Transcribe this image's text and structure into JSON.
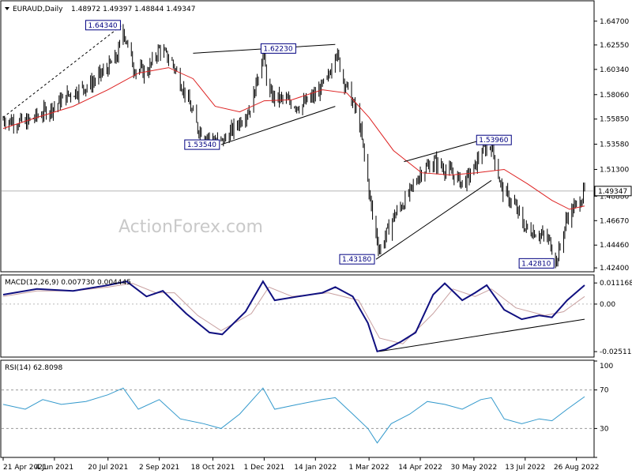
{
  "header": {
    "symbol": "EURAUD,Daily",
    "ohlc": "1.48972 1.49397 1.48844 1.49347",
    "watermark": "ActionForex.com"
  },
  "colors": {
    "candle": "#000000",
    "ma": "#dd2222",
    "macd": "#101080",
    "signal": "#c8a0a0",
    "rsi": "#3399cc",
    "grid": "#d8d8d8",
    "watermark": "#c9c9c9"
  },
  "chart_data": [
    {
      "type": "candlestick",
      "name": "price",
      "ylim": [
        1.4205,
        1.6647
      ],
      "yticks": [
        "1.64700",
        "1.62550",
        "1.60340",
        "1.58060",
        "1.55850",
        "1.53580",
        "1.51300",
        "1.48880",
        "1.46670",
        "1.44460",
        "1.42400"
      ],
      "current_price_label": "1.49347",
      "current_price": 1.49347,
      "annotations": [
        {
          "label": "1.64340",
          "value": 1.6434,
          "date": "2021-08-01",
          "anchor": "left"
        },
        {
          "label": "1.62230",
          "value": 1.6223,
          "date": "2021-12-01",
          "anchor": "right"
        },
        {
          "label": "1.53540",
          "value": 1.5354,
          "date": "2021-10-25",
          "anchor": "left"
        },
        {
          "label": "1.53960",
          "value": 1.5396,
          "date": "2022-06-04",
          "anchor": "right"
        },
        {
          "label": "1.43180",
          "value": 1.4318,
          "date": "2022-03-07",
          "anchor": "left"
        },
        {
          "label": "1.42810",
          "value": 1.4281,
          "date": "2022-08-08",
          "anchor": "left"
        }
      ],
      "trendlines": [
        {
          "style": "dashed",
          "from": [
            "2021-04-21",
            1.56
          ],
          "to": [
            "2021-08-01",
            1.6434
          ]
        },
        {
          "style": "solid",
          "from": [
            "2021-10-01",
            1.618
          ],
          "to": [
            "2022-01-31",
            1.626
          ]
        },
        {
          "style": "solid",
          "from": [
            "2021-10-25",
            1.5354
          ],
          "to": [
            "2022-01-31",
            1.57
          ]
        },
        {
          "style": "solid",
          "from": [
            "2022-03-31",
            1.52
          ],
          "to": [
            "2022-06-14",
            1.542
          ]
        },
        {
          "style": "solid",
          "from": [
            "2022-03-07",
            1.4318
          ],
          "to": [
            "2022-06-14",
            1.503
          ]
        }
      ],
      "close_path": [
        [
          "2021-04-21",
          1.558
        ],
        [
          "2021-05-10",
          1.555
        ],
        [
          "2021-06-04",
          1.57
        ],
        [
          "2021-06-15",
          1.58
        ],
        [
          "2021-07-05",
          1.59
        ],
        [
          "2021-07-20",
          1.605
        ],
        [
          "2021-07-28",
          1.615
        ],
        [
          "2021-08-02",
          1.64
        ],
        [
          "2021-08-11",
          1.605
        ],
        [
          "2021-08-22",
          1.6
        ],
        [
          "2021-09-02",
          1.622
        ],
        [
          "2021-09-13",
          1.61
        ],
        [
          "2021-09-25",
          1.58
        ],
        [
          "2021-10-05",
          1.55
        ],
        [
          "2021-10-18",
          1.54
        ],
        [
          "2021-10-26",
          1.538
        ],
        [
          "2021-11-05",
          1.55
        ],
        [
          "2021-11-20",
          1.57
        ],
        [
          "2021-11-30",
          1.62
        ],
        [
          "2021-12-05",
          1.58
        ],
        [
          "2021-12-20",
          1.575
        ],
        [
          "2022-01-01",
          1.57
        ],
        [
          "2022-01-14",
          1.58
        ],
        [
          "2022-01-25",
          1.595
        ],
        [
          "2022-01-31",
          1.622
        ],
        [
          "2022-02-07",
          1.595
        ],
        [
          "2022-02-20",
          1.56
        ],
        [
          "2022-02-27",
          1.51
        ],
        [
          "2022-03-04",
          1.47
        ],
        [
          "2022-03-10",
          1.44
        ],
        [
          "2022-03-22",
          1.47
        ],
        [
          "2022-04-04",
          1.49
        ],
        [
          "2022-04-14",
          1.51
        ],
        [
          "2022-04-26",
          1.52
        ],
        [
          "2022-05-10",
          1.51
        ],
        [
          "2022-05-21",
          1.5
        ],
        [
          "2022-05-31",
          1.515
        ],
        [
          "2022-06-05",
          1.53
        ],
        [
          "2022-06-14",
          1.535
        ],
        [
          "2022-06-23",
          1.495
        ],
        [
          "2022-07-04",
          1.48
        ],
        [
          "2022-07-13",
          1.46
        ],
        [
          "2022-07-25",
          1.455
        ],
        [
          "2022-08-03",
          1.448
        ],
        [
          "2022-08-09",
          1.43
        ],
        [
          "2022-08-18",
          1.47
        ],
        [
          "2022-08-29",
          1.485
        ],
        [
          "2022-09-02",
          1.4935
        ]
      ],
      "ma_path": [
        [
          "2021-04-21",
          1.55
        ],
        [
          "2021-05-20",
          1.56
        ],
        [
          "2021-06-20",
          1.57
        ],
        [
          "2021-07-20",
          1.585
        ],
        [
          "2021-08-15",
          1.6
        ],
        [
          "2021-09-10",
          1.605
        ],
        [
          "2021-10-01",
          1.595
        ],
        [
          "2021-10-20",
          1.57
        ],
        [
          "2021-11-10",
          1.565
        ],
        [
          "2021-12-01",
          1.575
        ],
        [
          "2021-12-25",
          1.576
        ],
        [
          "2022-01-20",
          1.585
        ],
        [
          "2022-02-10",
          1.582
        ],
        [
          "2022-03-01",
          1.56
        ],
        [
          "2022-03-22",
          1.53
        ],
        [
          "2022-04-15",
          1.51
        ],
        [
          "2022-05-10",
          1.508
        ],
        [
          "2022-06-01",
          1.51
        ],
        [
          "2022-06-25",
          1.513
        ],
        [
          "2022-07-15",
          1.5
        ],
        [
          "2022-08-05",
          1.485
        ],
        [
          "2022-08-20",
          1.477
        ],
        [
          "2022-09-02",
          1.48
        ]
      ]
    },
    {
      "type": "line",
      "name": "macd",
      "title": "MACD(12,26,9) 0.007730 0.004445",
      "ylim": [
        -0.028,
        0.015
      ],
      "yticks": [
        "0.011168",
        "0.00",
        "-0.025117"
      ],
      "series": [
        {
          "name": "macd",
          "points": [
            [
              "2021-04-21",
              0.005
            ],
            [
              "2021-05-20",
              0.008
            ],
            [
              "2021-06-20",
              0.007
            ],
            [
              "2021-07-20",
              0.01
            ],
            [
              "2021-08-05",
              0.012
            ],
            [
              "2021-08-22",
              0.004
            ],
            [
              "2021-09-05",
              0.007
            ],
            [
              "2021-09-25",
              -0.005
            ],
            [
              "2021-10-15",
              -0.015
            ],
            [
              "2021-10-26",
              -0.016
            ],
            [
              "2021-11-15",
              -0.004
            ],
            [
              "2021-11-30",
              0.012
            ],
            [
              "2021-12-10",
              0.002
            ],
            [
              "2021-12-30",
              0.004
            ],
            [
              "2022-01-20",
              0.006
            ],
            [
              "2022-01-31",
              0.009
            ],
            [
              "2022-02-15",
              0.004
            ],
            [
              "2022-02-28",
              -0.01
            ],
            [
              "2022-03-08",
              -0.025
            ],
            [
              "2022-03-15",
              -0.024
            ],
            [
              "2022-03-28",
              -0.02
            ],
            [
              "2022-04-10",
              -0.015
            ],
            [
              "2022-04-25",
              0.005
            ],
            [
              "2022-05-05",
              0.011
            ],
            [
              "2022-05-20",
              0.002
            ],
            [
              "2022-05-31",
              0.006
            ],
            [
              "2022-06-10",
              0.01
            ],
            [
              "2022-06-25",
              -0.003
            ],
            [
              "2022-07-10",
              -0.008
            ],
            [
              "2022-07-25",
              -0.006
            ],
            [
              "2022-08-05",
              -0.007
            ],
            [
              "2022-08-18",
              0.002
            ],
            [
              "2022-09-02",
              0.01
            ]
          ]
        },
        {
          "name": "signal",
          "points": [
            [
              "2021-04-21",
              0.004
            ],
            [
              "2021-05-20",
              0.007
            ],
            [
              "2021-06-20",
              0.007
            ],
            [
              "2021-07-20",
              0.009
            ],
            [
              "2021-08-10",
              0.011
            ],
            [
              "2021-08-30",
              0.006
            ],
            [
              "2021-09-15",
              0.006
            ],
            [
              "2021-10-05",
              -0.006
            ],
            [
              "2021-10-25",
              -0.014
            ],
            [
              "2021-11-20",
              -0.005
            ],
            [
              "2021-12-05",
              0.009
            ],
            [
              "2021-12-25",
              0.004
            ],
            [
              "2022-01-25",
              0.006
            ],
            [
              "2022-02-20",
              0.002
            ],
            [
              "2022-03-10",
              -0.018
            ],
            [
              "2022-03-30",
              -0.021
            ],
            [
              "2022-04-25",
              -0.005
            ],
            [
              "2022-05-12",
              0.008
            ],
            [
              "2022-05-31",
              0.004
            ],
            [
              "2022-06-14",
              0.008
            ],
            [
              "2022-07-05",
              -0.002
            ],
            [
              "2022-07-30",
              -0.006
            ],
            [
              "2022-08-15",
              -0.004
            ],
            [
              "2022-09-02",
              0.004
            ]
          ]
        }
      ],
      "trendline": {
        "from": [
          "2022-03-10",
          -0.025
        ],
        "to": [
          "2022-09-02",
          -0.008
        ]
      }
    },
    {
      "type": "line",
      "name": "rsi",
      "title": "RSI(14) 62.8098",
      "ylim": [
        0,
        100
      ],
      "yticks": [
        "100",
        "70",
        "30",
        "0"
      ],
      "reference_levels": [
        70,
        30
      ],
      "path": [
        [
          "2021-04-21",
          55
        ],
        [
          "2021-05-10",
          50
        ],
        [
          "2021-05-25",
          60
        ],
        [
          "2021-06-10",
          55
        ],
        [
          "2021-07-01",
          58
        ],
        [
          "2021-07-20",
          65
        ],
        [
          "2021-08-02",
          72
        ],
        [
          "2021-08-15",
          50
        ],
        [
          "2021-09-02",
          60
        ],
        [
          "2021-09-20",
          40
        ],
        [
          "2021-10-10",
          35
        ],
        [
          "2021-10-25",
          30
        ],
        [
          "2021-11-10",
          45
        ],
        [
          "2021-11-30",
          72
        ],
        [
          "2021-12-10",
          50
        ],
        [
          "2021-12-30",
          55
        ],
        [
          "2022-01-20",
          60
        ],
        [
          "2022-01-31",
          62
        ],
        [
          "2022-02-15",
          45
        ],
        [
          "2022-02-28",
          30
        ],
        [
          "2022-03-08",
          15
        ],
        [
          "2022-03-20",
          35
        ],
        [
          "2022-04-05",
          45
        ],
        [
          "2022-04-20",
          58
        ],
        [
          "2022-05-05",
          55
        ],
        [
          "2022-05-20",
          50
        ],
        [
          "2022-06-05",
          60
        ],
        [
          "2022-06-14",
          62
        ],
        [
          "2022-06-25",
          40
        ],
        [
          "2022-07-10",
          35
        ],
        [
          "2022-07-25",
          40
        ],
        [
          "2022-08-05",
          38
        ],
        [
          "2022-08-18",
          50
        ],
        [
          "2022-09-02",
          63
        ]
      ]
    }
  ],
  "x_axis": {
    "labels": [
      {
        "text": "21 Apr 2021",
        "date": "2021-04-21"
      },
      {
        "text": "4 Jun 2021",
        "date": "2021-06-04"
      },
      {
        "text": "20 Jul 2021",
        "date": "2021-07-20"
      },
      {
        "text": "2 Sep 2021",
        "date": "2021-09-02"
      },
      {
        "text": "18 Oct 2021",
        "date": "2021-10-18"
      },
      {
        "text": "1 Dec 2021",
        "date": "2021-12-01"
      },
      {
        "text": "14 Jan 2022",
        "date": "2022-01-14"
      },
      {
        "text": "1 Mar 2022",
        "date": "2022-03-01"
      },
      {
        "text": "14 Apr 2022",
        "date": "2022-04-14"
      },
      {
        "text": "30 May 2022",
        "date": "2022-05-30"
      },
      {
        "text": "13 Jul 2022",
        "date": "2022-07-13"
      },
      {
        "text": "26 Aug 2022",
        "date": "2022-08-26"
      }
    ]
  }
}
